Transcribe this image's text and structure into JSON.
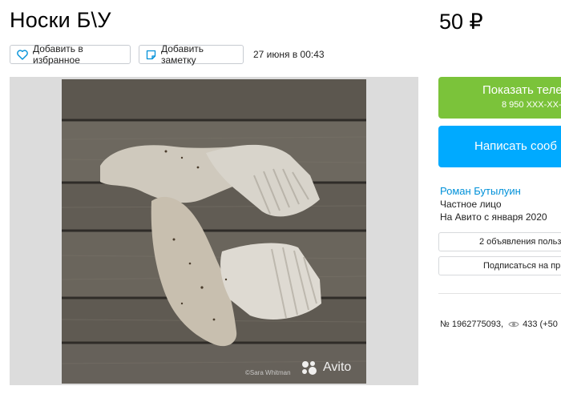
{
  "listing": {
    "title": "Носки Б\\У",
    "price": "50 ₽",
    "date": "27 июня в 00:43"
  },
  "actions": {
    "favorite_label": "Добавить в избранное",
    "note_label": "Добавить заметку"
  },
  "gallery": {
    "watermark": "Avito",
    "credit": "©Sara Whitman"
  },
  "contact": {
    "show_phone_label": "Показать теле",
    "phone_masked": "8 950 XXX-XX-",
    "write_label": "Написать сооб"
  },
  "seller": {
    "name": "Роман Бутылуин",
    "type": "Частное лицо",
    "since": "На Авито с января 2020",
    "ads_label": "2 объявления польз",
    "subscribe_label": "Подписаться на пр"
  },
  "stats": {
    "item_number": "№ 1962775093,",
    "views": "433 (+50"
  },
  "colors": {
    "green": "#7bc33a",
    "blue": "#00aaff",
    "link": "#0091d9"
  }
}
